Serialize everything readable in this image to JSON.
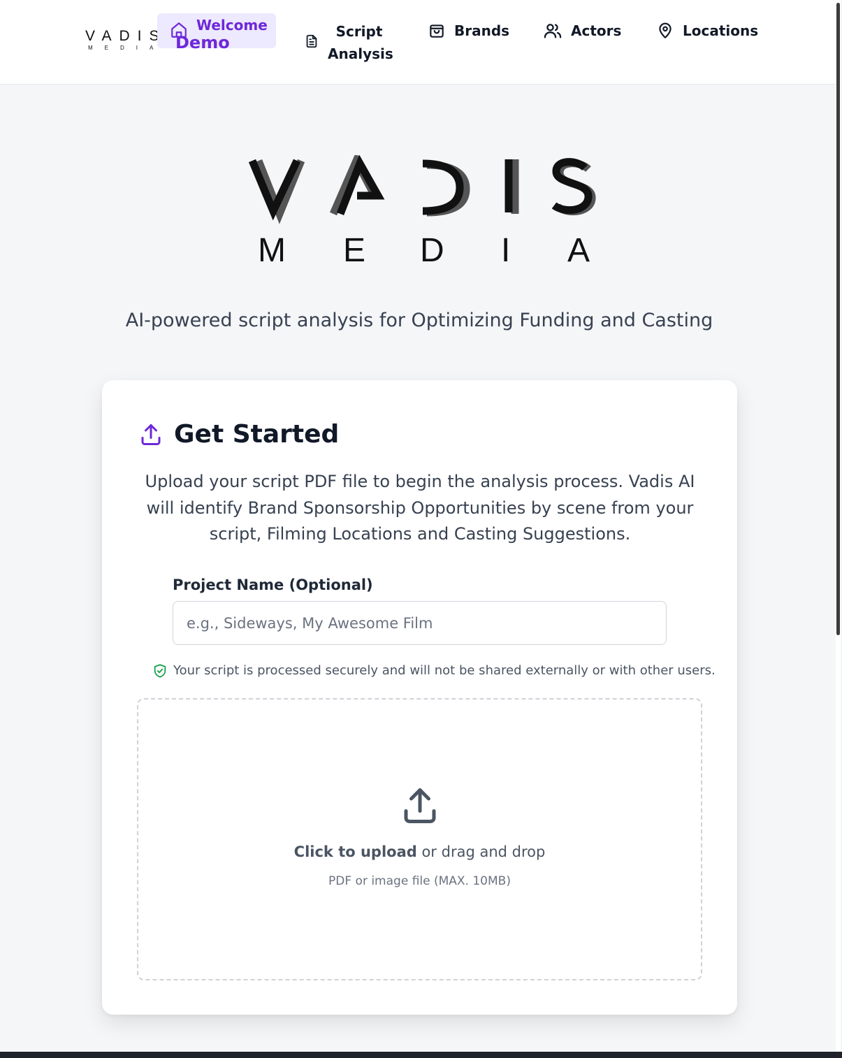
{
  "nav": {
    "logo": {
      "main": "VADIS",
      "sub": "MEDIA"
    },
    "items": [
      {
        "label": "Welcome",
        "icon": "home-icon",
        "active": true,
        "overlay": "Demo"
      },
      {
        "label_line1": "Script",
        "label_line2": "Analysis",
        "icon": "document-icon"
      },
      {
        "label": "Brands",
        "icon": "shopping-bag-icon"
      },
      {
        "label": "Actors",
        "icon": "users-icon"
      },
      {
        "label": "Locations",
        "icon": "map-pin-icon"
      }
    ]
  },
  "hero": {
    "logo_main": "VADIS",
    "logo_sub": "MEDIA",
    "tagline": "AI-powered script analysis for Optimizing Funding and Casting"
  },
  "card": {
    "title": "Get Started",
    "intro": "Upload your script PDF file to begin the analysis process. Vadis AI will identify Brand Sponsorship Opportunities by scene from your script, Filming Locations and Casting Suggestions.",
    "project_label": "Project Name (Optional)",
    "project_placeholder": "e.g., Sideways, My Awesome Film",
    "project_value": "",
    "secure_note": "Your script is processed securely and will not be shared externally or with other users.",
    "upload": {
      "cta_bold": "Click to upload",
      "cta_rest": " or drag and drop",
      "hint": "PDF or image file (MAX. 10MB)"
    }
  },
  "colors": {
    "accent": "#6d28d9",
    "accent_bg": "#ede9fe",
    "page_bg": "#f5f6f8",
    "secure_green": "#16a34a"
  }
}
